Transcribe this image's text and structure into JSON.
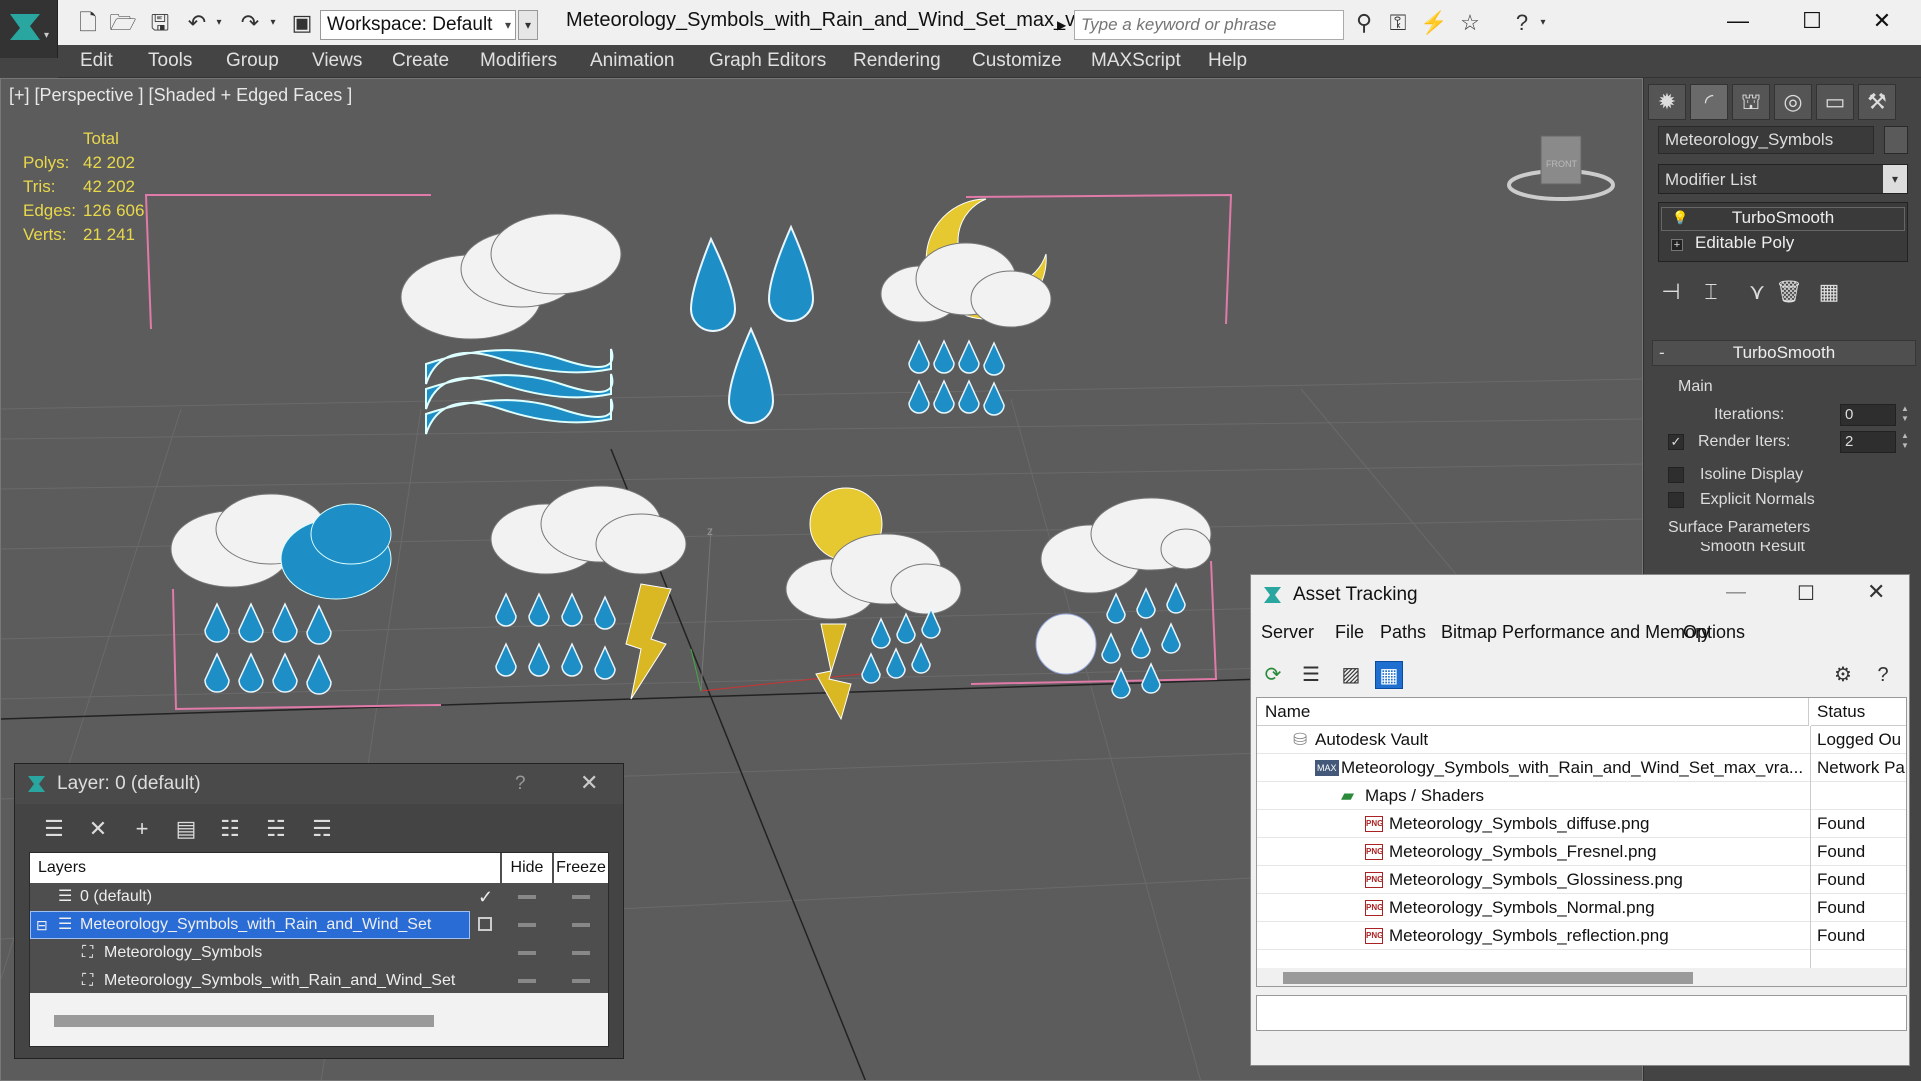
{
  "titlebar": {
    "workspace": "Workspace: Default",
    "document_title": "Meteorology_Symbols_with_Rain_and_Wind_Set_max_vray....",
    "search_placeholder": "Type a keyword or phrase"
  },
  "menu": [
    "Edit",
    "Tools",
    "Group",
    "Views",
    "Create",
    "Modifiers",
    "Animation",
    "Graph Editors",
    "Rendering",
    "Customize",
    "MAXScript",
    "Help"
  ],
  "viewport": {
    "label": "[+] [Perspective ] [Shaded + Edged Faces ]",
    "stats_header": "Total",
    "stats": [
      {
        "label": "Polys:",
        "value": "42 202"
      },
      {
        "label": "Tris:",
        "value": "42 202"
      },
      {
        "label": "Edges:",
        "value": "126 606"
      },
      {
        "label": "Verts:",
        "value": "21 241"
      }
    ],
    "viewcube_label": "FRONT",
    "axis_z": "z"
  },
  "command_panel": {
    "object_name": "Meteorology_Symbols",
    "modifier_list": "Modifier List",
    "stack": [
      "TurboSmooth",
      "Editable Poly"
    ],
    "rollout_title": "TurboSmooth",
    "group_main": "Main",
    "iterations_label": "Iterations:",
    "iterations_value": "0",
    "render_iters_label": "Render Iters:",
    "render_iters_value": "2",
    "render_iters_checked": true,
    "isoline_label": "Isoline Display",
    "explicit_normals_label": "Explicit Normals",
    "surface_params_label": "Surface Parameters",
    "smooth_result_label": "Smooth Result"
  },
  "layer_dialog": {
    "title": "Layer: 0 (default)",
    "help": "?",
    "columns": {
      "layers": "Layers",
      "hide": "Hide",
      "freeze": "Freeze"
    },
    "rows": [
      {
        "name": "0 (default)",
        "indent": 0,
        "selected": false,
        "current": true
      },
      {
        "name": "Meteorology_Symbols_with_Rain_and_Wind_Set",
        "indent": 0,
        "selected": true,
        "current": false
      },
      {
        "name": "Meteorology_Symbols",
        "indent": 1,
        "selected": false,
        "current": false
      },
      {
        "name": "Meteorology_Symbols_with_Rain_and_Wind_Set",
        "indent": 1,
        "selected": false,
        "current": false
      }
    ]
  },
  "asset_tracking": {
    "title": "Asset Tracking",
    "menus": [
      "Server",
      "File",
      "Paths",
      "Bitmap Performance and Memory",
      "Options"
    ],
    "columns": {
      "name": "Name",
      "status": "Status"
    },
    "rows": [
      {
        "name": "Autodesk Vault",
        "status": "Logged Ou",
        "indent": 1,
        "icon": "vault"
      },
      {
        "name": "Meteorology_Symbols_with_Rain_and_Wind_Set_max_vra...",
        "status": "Network Pa",
        "indent": 2,
        "icon": "max"
      },
      {
        "name": "Maps / Shaders",
        "status": "",
        "indent": 3,
        "icon": "maps"
      },
      {
        "name": "Meteorology_Symbols_diffuse.png",
        "status": "Found",
        "indent": 4,
        "icon": "png"
      },
      {
        "name": "Meteorology_Symbols_Fresnel.png",
        "status": "Found",
        "indent": 4,
        "icon": "png"
      },
      {
        "name": "Meteorology_Symbols_Glossiness.png",
        "status": "Found",
        "indent": 4,
        "icon": "png"
      },
      {
        "name": "Meteorology_Symbols_Normal.png",
        "status": "Found",
        "indent": 4,
        "icon": "png"
      },
      {
        "name": "Meteorology_Symbols_reflection.png",
        "status": "Found",
        "indent": 4,
        "icon": "png"
      }
    ]
  },
  "icons": {
    "png_badge": "PNG",
    "max_badge": "MAX"
  },
  "colors": {
    "selection": "#2a6cd6",
    "stats": "#e9d84a",
    "drop": "#1e8fc6",
    "bolt": "#d9b824",
    "bounding": "#e07aa8"
  }
}
